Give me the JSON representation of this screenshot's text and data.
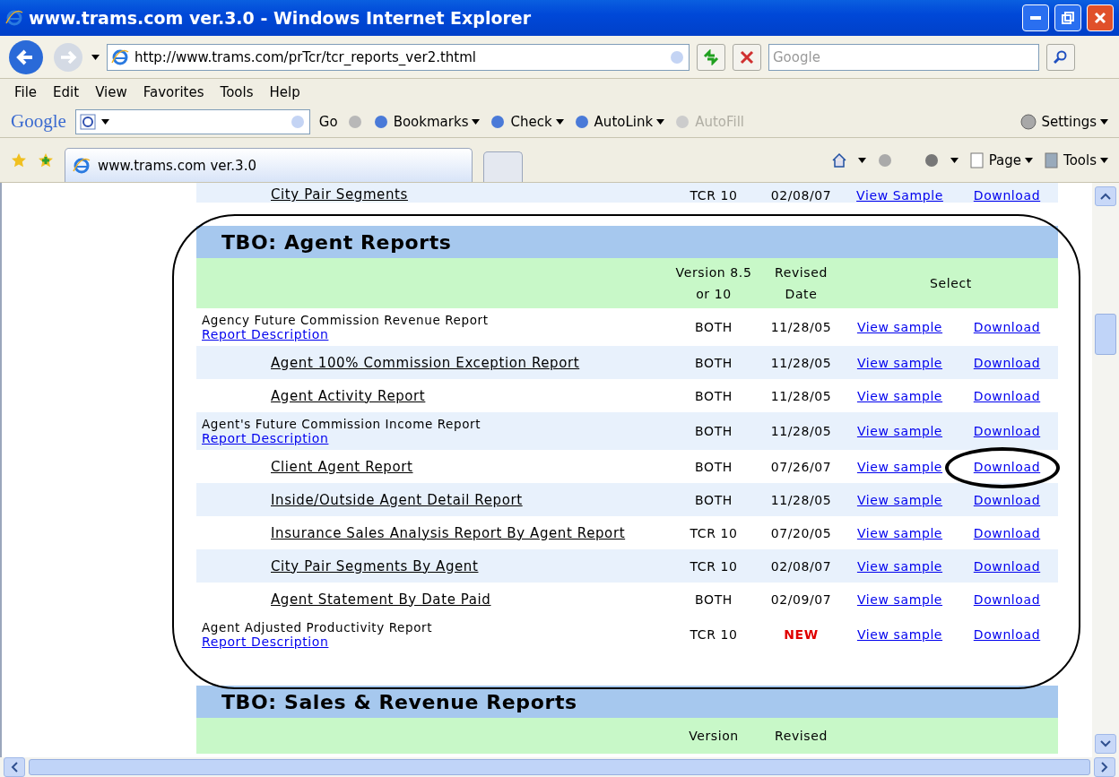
{
  "window": {
    "title": "www.trams.com ver.3.0 - Windows Internet Explorer"
  },
  "address_bar": {
    "url": "http://www.trams.com/prTcr/tcr_reports_ver2.thtml"
  },
  "search": {
    "placeholder": "Google"
  },
  "menu": [
    "File",
    "Edit",
    "View",
    "Favorites",
    "Tools",
    "Help"
  ],
  "google_toolbar": {
    "logo": "Google",
    "go": "Go",
    "buttons": [
      {
        "label": "Bookmarks",
        "disabled": false
      },
      {
        "label": "Check",
        "disabled": false
      },
      {
        "label": "AutoLink",
        "disabled": false
      },
      {
        "label": "AutoFill",
        "disabled": true
      }
    ],
    "settings": "Settings"
  },
  "tabs": [
    {
      "label": "www.trams.com ver.3.0",
      "selected": true
    }
  ],
  "command_bar": [
    {
      "label": "Page"
    },
    {
      "label": "Tools"
    }
  ],
  "cut_row": {
    "name": "City Pair Segments",
    "version": "TCR 10",
    "date": "02/08/07",
    "view": "View Sample",
    "download": "Download"
  },
  "section": {
    "title": "TBO: Agent Reports",
    "columns": [
      "Version 8.5 or 10",
      "Revised Date",
      "Select"
    ],
    "rows": [
      {
        "kind": "group",
        "name": "Agency Future Commission Revenue Report",
        "link": "Report Description",
        "version": "BOTH",
        "date": "11/28/05",
        "is_new": false,
        "view": "View sample",
        "download": "Download",
        "shaded": false,
        "circled": false
      },
      {
        "kind": "item",
        "name": "Agent 100% Commission Exception Report",
        "version": "BOTH",
        "date": "11/28/05",
        "is_new": false,
        "view": "View sample",
        "download": "Download",
        "shaded": true,
        "circled": false
      },
      {
        "kind": "item",
        "name": "Agent Activity Report",
        "version": "BOTH",
        "date": "11/28/05",
        "is_new": false,
        "view": "View sample",
        "download": "Download",
        "shaded": false,
        "circled": false
      },
      {
        "kind": "group",
        "name": "Agent's Future Commission Income Report",
        "link": "Report Description",
        "version": "BOTH",
        "date": "11/28/05",
        "is_new": false,
        "view": "View sample",
        "download": "Download",
        "shaded": true,
        "circled": false
      },
      {
        "kind": "item",
        "name": "Client Agent Report",
        "version": "BOTH",
        "date": "07/26/07",
        "is_new": false,
        "view": "View sample",
        "download": "Download",
        "shaded": false,
        "circled": true
      },
      {
        "kind": "item",
        "name": "Inside/Outside Agent Detail Report",
        "version": "BOTH",
        "date": "11/28/05",
        "is_new": false,
        "view": "View sample",
        "download": "Download",
        "shaded": true,
        "circled": false
      },
      {
        "kind": "item",
        "name": "Insurance Sales Analysis Report By Agent Report",
        "version": "TCR 10",
        "date": "07/20/05",
        "is_new": false,
        "view": "View sample",
        "download": "Download",
        "shaded": false,
        "circled": false
      },
      {
        "kind": "item",
        "name": "City Pair Segments By Agent",
        "version": "TCR 10",
        "date": "02/08/07",
        "is_new": false,
        "view": "View sample",
        "download": "Download",
        "shaded": true,
        "circled": false
      },
      {
        "kind": "item",
        "name": "Agent Statement By Date Paid",
        "version": "BOTH",
        "date": "02/09/07",
        "is_new": false,
        "view": "View sample",
        "download": "Download",
        "shaded": false,
        "circled": false
      },
      {
        "kind": "group",
        "name": "Agent Adjusted Productivity Report",
        "link": "Report Description",
        "version": "TCR 10",
        "date": "NEW",
        "is_new": true,
        "view": "View sample",
        "download": "Download",
        "shaded": false,
        "circled": false
      }
    ]
  },
  "next_section": {
    "title": "TBO: Sales & Revenue Reports",
    "columns": [
      "Version",
      "Revised"
    ]
  }
}
